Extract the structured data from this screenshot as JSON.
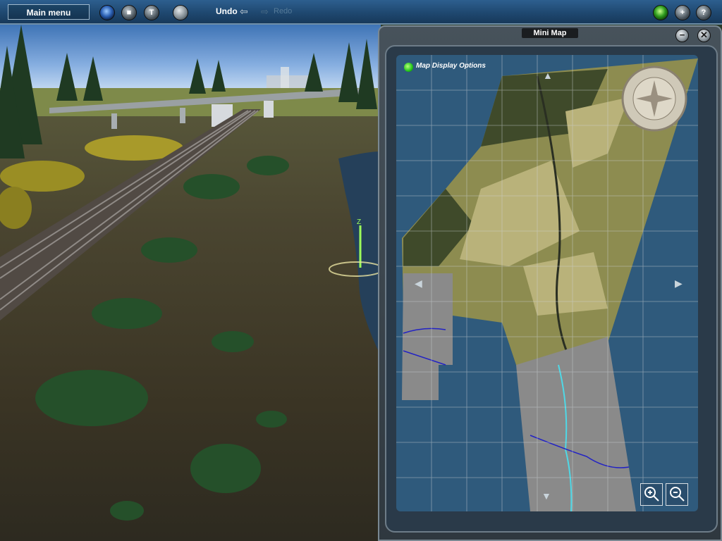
{
  "toolbar": {
    "main_menu_label": "Main menu",
    "undo_label": "Undo",
    "redo_label": "Redo"
  },
  "minimap": {
    "title": "Mini Map",
    "display_options_label": "Map Display Options",
    "minimize_glyph": "−",
    "close_glyph": "✕"
  },
  "colors": {
    "toolbar": "#1f4870",
    "water": "#2f5a7c",
    "terrain_light": "#b9b27a",
    "terrain_dark": "#3f4a2a",
    "urban_tiles": "#8a8a8a",
    "rail": "#8f8a86"
  }
}
